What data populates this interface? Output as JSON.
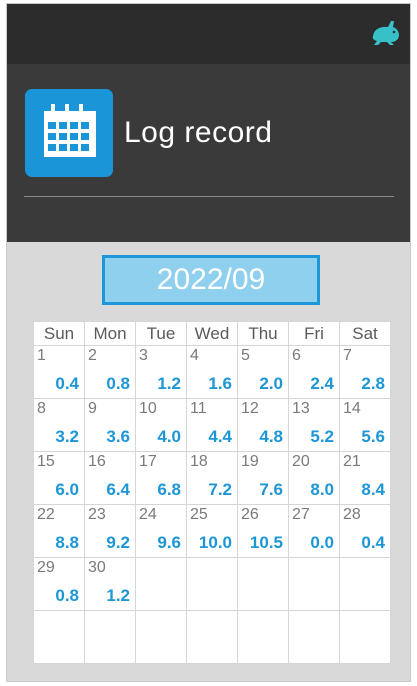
{
  "header": {
    "title": "Log record",
    "icon": "calendar-icon",
    "logo_icon": "rabbit-logo-icon",
    "accent": "#1a96d8"
  },
  "calendar": {
    "month_label": "2022/09",
    "weekdays": [
      "Sun",
      "Mon",
      "Tue",
      "Wed",
      "Thu",
      "Fri",
      "Sat"
    ],
    "weeks": [
      [
        {
          "day": "1",
          "value": "0.4"
        },
        {
          "day": "2",
          "value": "0.8"
        },
        {
          "day": "3",
          "value": "1.2"
        },
        {
          "day": "4",
          "value": "1.6"
        },
        {
          "day": "5",
          "value": "2.0"
        },
        {
          "day": "6",
          "value": "2.4"
        },
        {
          "day": "7",
          "value": "2.8"
        }
      ],
      [
        {
          "day": "8",
          "value": "3.2"
        },
        {
          "day": "9",
          "value": "3.6"
        },
        {
          "day": "10",
          "value": "4.0"
        },
        {
          "day": "11",
          "value": "4.4"
        },
        {
          "day": "12",
          "value": "4.8"
        },
        {
          "day": "13",
          "value": "5.2"
        },
        {
          "day": "14",
          "value": "5.6"
        }
      ],
      [
        {
          "day": "15",
          "value": "6.0"
        },
        {
          "day": "16",
          "value": "6.4"
        },
        {
          "day": "17",
          "value": "6.8"
        },
        {
          "day": "18",
          "value": "7.2"
        },
        {
          "day": "19",
          "value": "7.6"
        },
        {
          "day": "20",
          "value": "8.0"
        },
        {
          "day": "21",
          "value": "8.4"
        }
      ],
      [
        {
          "day": "22",
          "value": "8.8"
        },
        {
          "day": "23",
          "value": "9.2"
        },
        {
          "day": "24",
          "value": "9.6"
        },
        {
          "day": "25",
          "value": "10.0"
        },
        {
          "day": "26",
          "value": "10.5"
        },
        {
          "day": "27",
          "value": "0.0"
        },
        {
          "day": "28",
          "value": "0.4"
        }
      ],
      [
        {
          "day": "29",
          "value": "0.8"
        },
        {
          "day": "30",
          "value": "1.2"
        },
        null,
        null,
        null,
        null,
        null
      ],
      [
        null,
        null,
        null,
        null,
        null,
        null,
        null
      ]
    ]
  }
}
